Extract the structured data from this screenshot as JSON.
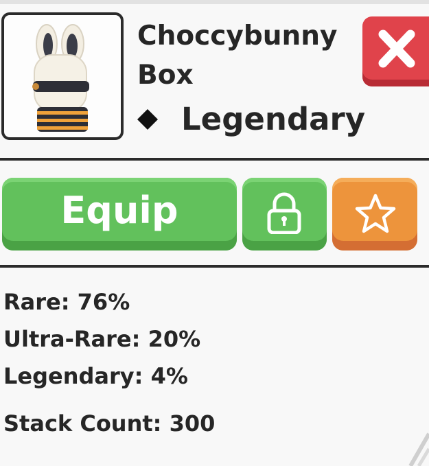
{
  "item": {
    "name": "Choccybunny Box",
    "rarity": "Legendary",
    "image_icon": "choccybunny-box-icon"
  },
  "actions": {
    "equip_label": "Equip",
    "lock_icon": "lock-icon",
    "favorite_icon": "star-icon",
    "close_icon": "close-icon"
  },
  "odds": {
    "rare": "Rare: 76%",
    "ultra_rare": "Ultra-Rare: 20%",
    "legendary": "Legendary: 4%"
  },
  "stack_count": "Stack Count: 300",
  "colors": {
    "green_button": "#62c15c",
    "orange_button": "#ed943c",
    "close_button": "#e0434b",
    "text": "#262626"
  }
}
